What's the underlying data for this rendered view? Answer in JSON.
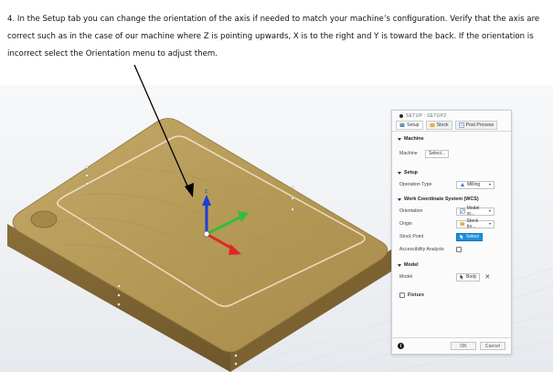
{
  "instruction": {
    "text": "4. In the Setup tab you can change the orientation of the axis if needed to match your machine’s configuration.  Verify that the axis are correct such as in the case of our machine where Z is pointing upwards, X is to the right and Y is toward the back.  If the orientation is incorrect select the Orientation menu to adjust them."
  },
  "axes": {
    "z_label": "Z"
  },
  "panel": {
    "title": "SETUP : SETUP2",
    "tabs": [
      {
        "label": "Setup",
        "icon": "setup-icon"
      },
      {
        "label": "Stock",
        "icon": "stock-icon"
      },
      {
        "label": "Post Process",
        "icon": "post-process-icon"
      }
    ],
    "machine": {
      "header": "Machine",
      "label": "Machine",
      "button": "Select..."
    },
    "setup": {
      "header": "Setup",
      "operation_type_label": "Operation Type",
      "operation_type_value": "Milling"
    },
    "wcs": {
      "header": "Work Coordinate System (WCS)",
      "orientation_label": "Orientation",
      "orientation_value": "Model or...",
      "origin_label": "Origin",
      "origin_value": "Stock bo...",
      "stock_point_label": "Stock Point",
      "stock_point_value": "Select",
      "accessibility_label": "Accessibility Analysis"
    },
    "model": {
      "header": "Model",
      "label": "Model",
      "value": "Body"
    },
    "fixture": {
      "label": "Fixture"
    },
    "footer": {
      "info": "i",
      "ok": "OK",
      "cancel": "Cancel"
    }
  },
  "colors": {
    "accent": "#1e8fdb",
    "z_axis": "#1a3fd6",
    "x_axis": "#e0262a",
    "y_axis": "#2fbf3a",
    "wood": "#b79a5c"
  }
}
